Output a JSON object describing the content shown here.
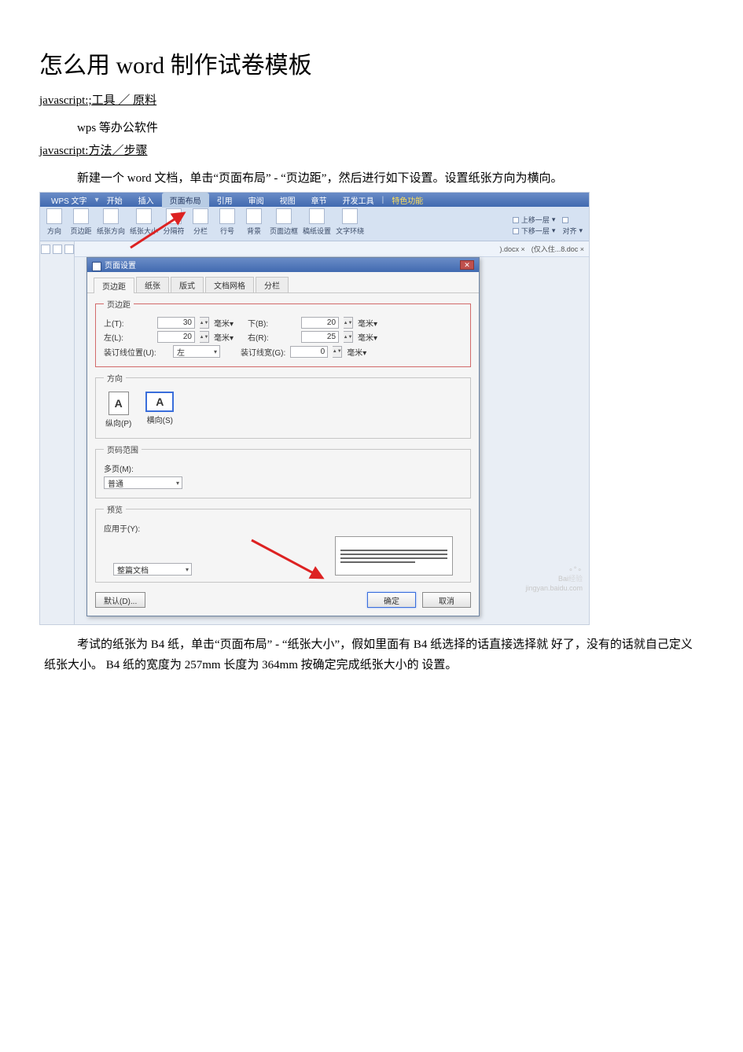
{
  "title": "怎么用 word 制作试卷模板",
  "link1_prefix": "javascript:;",
  "link1": "工具 ／ 原料",
  "tools_text": "wps 等办公软件",
  "link2_prefix": "javascript:",
  "link2": "方法／步骤",
  "para1_a": "新建一个 word 文档，单击“页面布局” - “页边距”，然后进行如下设置。设置纸张方向为横向。",
  "para2_a": "考试的纸张为 B4 纸，单击“页面布局” - “纸张大小”，假如里面有 B4 纸选择的话直接选择就 好了，没有的话就自己定义纸张大小。  B4 纸的宽度为 257mm 长度为 364mm 按确定完成纸张大小的  设置。",
  "app": {
    "name": "WPS 文字",
    "tabs": [
      "开始",
      "插入",
      "页面布局",
      "引用",
      "审阅",
      "视图",
      "章节",
      "开发工具"
    ],
    "special_tab": "特色功能",
    "ribbon_btns": [
      "方向",
      "页边距",
      "纸张方向",
      "纸张大小",
      "分隔符",
      "分栏",
      "行号",
      "背景",
      "页面边框",
      "稿纸设置",
      "文字环绕"
    ],
    "rib_side": {
      "a": "上移一层",
      "b": "下移一层",
      "c": "对齐"
    },
    "doc_tabs": [
      ").docx ×",
      "(仅入住...8.doc ×"
    ]
  },
  "dialog": {
    "title": "页面设置",
    "tabs": [
      "页边距",
      "纸张",
      "版式",
      "文档网格",
      "分栏"
    ],
    "group_margin": "页边距",
    "top_lbl": "上(T):",
    "top_val": "30",
    "unit_mm_t": "毫米",
    "bottom_lbl": "下(B):",
    "bottom_val": "20",
    "unit_mm_b": "毫米",
    "left_lbl": "左(L):",
    "left_val": "20",
    "unit_mm_l": "毫米",
    "right_lbl": "右(R):",
    "right_val": "25",
    "unit_mm_r": "毫米",
    "gutter_pos_lbl": "装订线位置(U):",
    "gutter_pos_val": "左",
    "gutter_w_lbl": "装订线宽(G):",
    "gutter_w_val": "0",
    "unit_mm_g": "毫米",
    "group_orient": "方向",
    "portrait": "纵向(P)",
    "landscape": "横向(S)",
    "group_pages": "页码范围",
    "multi_lbl": "多页(M):",
    "multi_val": "普通",
    "group_preview": "预览",
    "apply_lbl": "应用于(Y):",
    "apply_val": "整篇文档",
    "default_btn": "默认(D)...",
    "ok_btn": "确定",
    "cancel_btn": "取消"
  },
  "watermark": {
    "a": "Bai",
    "b": "经验",
    "c": "jingyan.baidu.com"
  }
}
